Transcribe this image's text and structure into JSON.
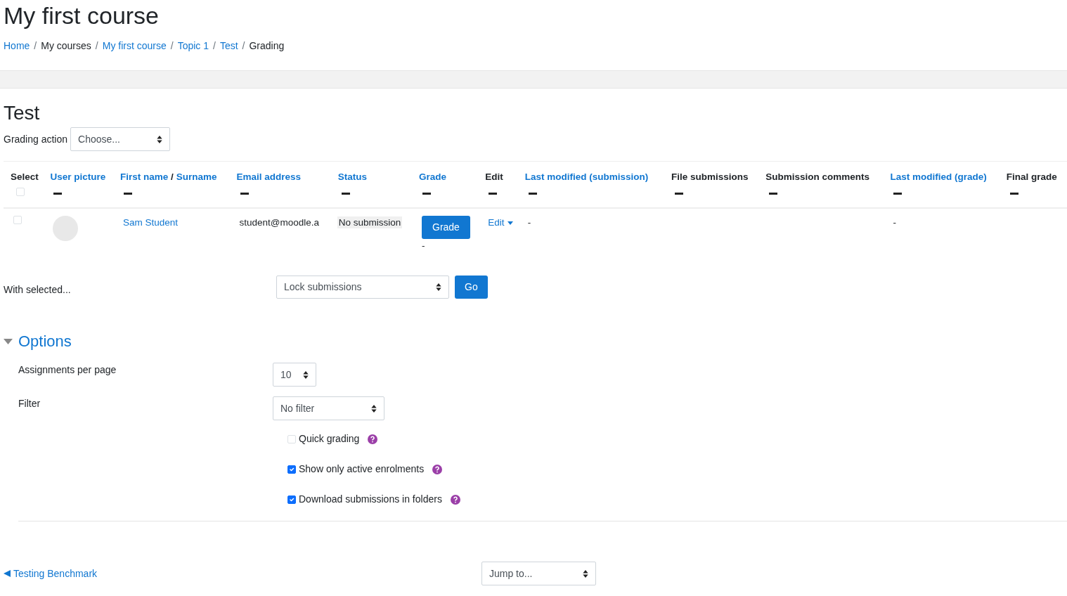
{
  "page_title": "My first course",
  "breadcrumb": {
    "separator": "/",
    "items": [
      {
        "label": "Home",
        "link": true
      },
      {
        "label": "My courses",
        "link": false
      },
      {
        "label": "My first course",
        "link": true
      },
      {
        "label": "Topic 1",
        "link": true
      },
      {
        "label": "Test",
        "link": true
      },
      {
        "label": "Grading",
        "link": false
      }
    ]
  },
  "heading": "Test",
  "grading_action": {
    "label": "Grading action",
    "value": "Choose..."
  },
  "table": {
    "columns": [
      {
        "kind": "select",
        "label": "Select",
        "checked": false
      },
      {
        "kind": "link",
        "label": "User picture"
      },
      {
        "kind": "pair",
        "labels": [
          "First name",
          "Surname"
        ],
        "separator": "/"
      },
      {
        "kind": "link",
        "label": "Email address"
      },
      {
        "kind": "link",
        "label": "Status"
      },
      {
        "kind": "link",
        "label": "Grade"
      },
      {
        "kind": "text",
        "label": "Edit"
      },
      {
        "kind": "link",
        "label": "Last modified (submission)"
      },
      {
        "kind": "text",
        "label": "File submissions"
      },
      {
        "kind": "text",
        "label": "Submission comments"
      },
      {
        "kind": "link",
        "label": "Last modified (grade)"
      },
      {
        "kind": "text",
        "label": "Final grade"
      }
    ],
    "rows": [
      {
        "selected": false,
        "name": "Sam Student",
        "email": "student@moodle.a",
        "status": "No submission",
        "grade_button": "Grade",
        "grade": "-",
        "edit": "Edit",
        "last_modified_submission": "-",
        "last_modified_grade": "-"
      }
    ]
  },
  "bulk": {
    "label": "With selected...",
    "value": "Lock submissions",
    "button": "Go"
  },
  "options": {
    "title": "Options",
    "expanded": true,
    "selects": [
      {
        "label": "Assignments per page",
        "value": "10"
      },
      {
        "label": "Filter",
        "value": "No filter"
      }
    ],
    "checkboxes": [
      {
        "label": "Quick grading",
        "checked": false
      },
      {
        "label": "Show only active enrolments",
        "checked": true
      },
      {
        "label": "Download submissions in folders",
        "checked": true
      }
    ]
  },
  "footer": {
    "prev_link": "Testing Benchmark",
    "jump": "Jump to..."
  }
}
